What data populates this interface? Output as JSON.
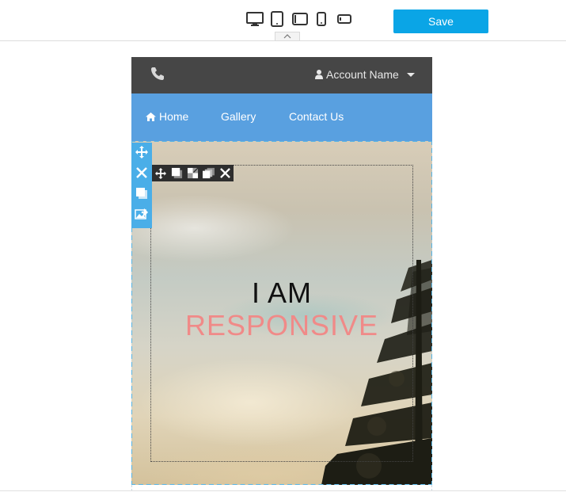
{
  "toolbar": {
    "devices": [
      {
        "name": "desktop-icon"
      },
      {
        "name": "tablet-portrait-icon"
      },
      {
        "name": "tablet-landscape-icon"
      },
      {
        "name": "phone-portrait-icon"
      },
      {
        "name": "phone-landscape-icon"
      }
    ],
    "save_label": "Save"
  },
  "site": {
    "account_name": "Account Name",
    "nav": [
      {
        "label": "Home",
        "icon": "home-icon"
      },
      {
        "label": "Gallery"
      },
      {
        "label": "Contact Us"
      }
    ],
    "hero": {
      "line1": "I AM",
      "line2": "RESPONSIVE"
    }
  },
  "colors": {
    "save": "#0aa5e6",
    "account_bar": "#464646",
    "nav": "#59a0e0",
    "selection": "#4aaee8",
    "hero_accent": "#f08a88"
  },
  "tools": {
    "side": [
      "move-icon",
      "delete-icon",
      "duplicate-icon",
      "edit-image-icon"
    ],
    "inline": [
      "move-icon",
      "duplicate-icon",
      "copy-style-icon",
      "paste-icon",
      "delete-icon"
    ]
  }
}
